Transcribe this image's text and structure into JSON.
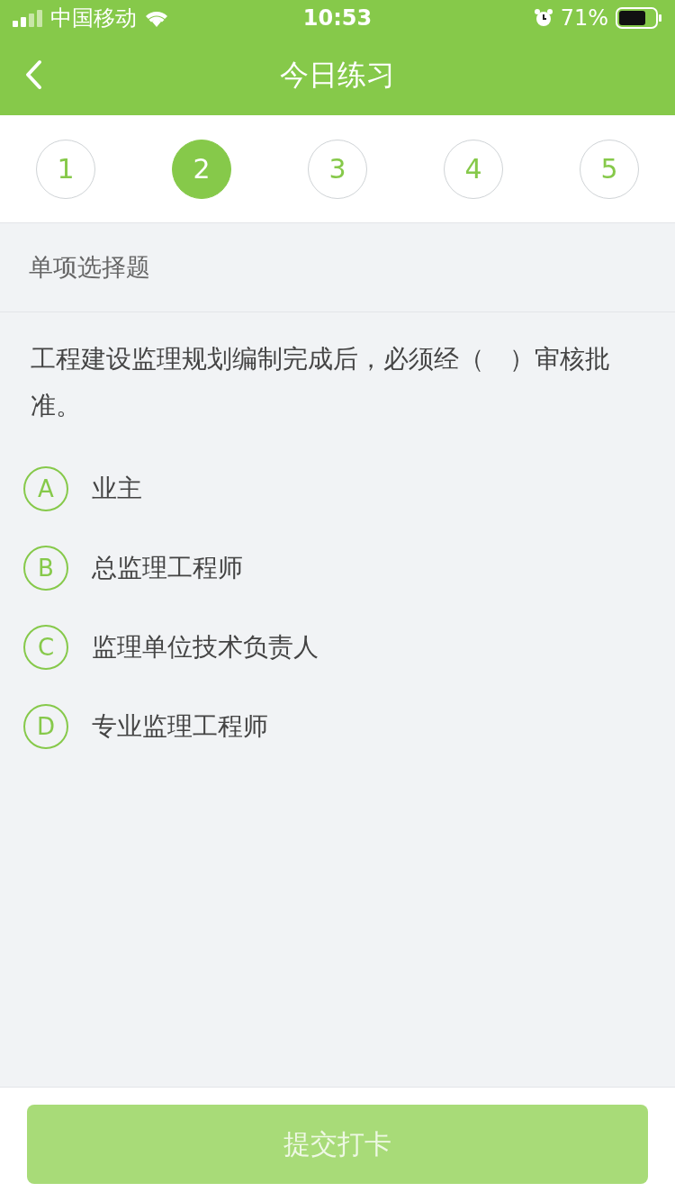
{
  "status_bar": {
    "carrier": "中国移动",
    "time": "10:53",
    "battery": "71%"
  },
  "nav": {
    "title": "今日练习"
  },
  "steps": [
    {
      "label": "1",
      "selected": false
    },
    {
      "label": "2",
      "selected": true
    },
    {
      "label": "3",
      "selected": false
    },
    {
      "label": "4",
      "selected": false
    },
    {
      "label": "5",
      "selected": false
    }
  ],
  "section": {
    "title": "单项选择题"
  },
  "question": {
    "text": "工程建设监理规划编制完成后，必须经（　）审核批准。"
  },
  "options": [
    {
      "letter": "A",
      "text": "业主",
      "selected": false
    },
    {
      "letter": "B",
      "text": "总监理工程师",
      "selected": false
    },
    {
      "letter": "C",
      "text": "监理单位技术负责人",
      "selected": false
    },
    {
      "letter": "D",
      "text": "专业监理工程师",
      "selected": false
    }
  ],
  "submit": {
    "label": "提交打卡",
    "disabled": true
  }
}
